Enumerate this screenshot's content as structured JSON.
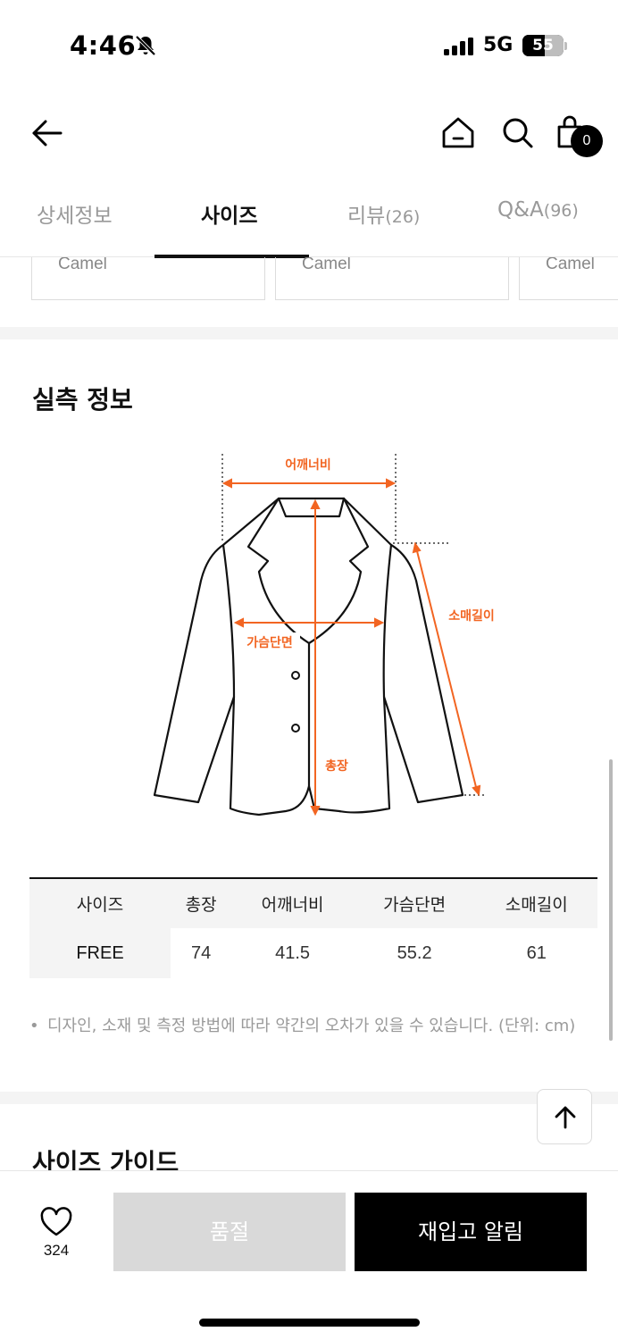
{
  "status": {
    "time": "4:46",
    "network": "5G",
    "battery": "55"
  },
  "nav": {
    "cart_count": "0"
  },
  "tabs": [
    {
      "label": "상세정보",
      "count": ""
    },
    {
      "label": "사이즈",
      "count": ""
    },
    {
      "label": "리뷰",
      "count": "(26)"
    },
    {
      "label": "Q&A",
      "count": "(96)"
    }
  ],
  "colors": [
    "Camel",
    "Camel",
    "Camel"
  ],
  "measure": {
    "title": "실측 정보",
    "diagram_labels": {
      "shoulder": "어깨너비",
      "sleeve": "소매길이",
      "chest": "가슴단면",
      "length": "총장"
    },
    "accent_color": "#f26522",
    "table": {
      "headers": [
        "사이즈",
        "총장",
        "어깨너비",
        "가슴단면",
        "소매길이"
      ],
      "rows": [
        [
          "FREE",
          "74",
          "41.5",
          "55.2",
          "61"
        ]
      ]
    },
    "note": "디자인, 소재 및 측정 방법에 따라 약간의 오차가 있을 수 있습니다. (단위: cm)"
  },
  "guide": {
    "title": "사이즈 가이드"
  },
  "bottom": {
    "likes": "324",
    "soldout_label": "품절",
    "restock_label": "재입고 알림"
  }
}
